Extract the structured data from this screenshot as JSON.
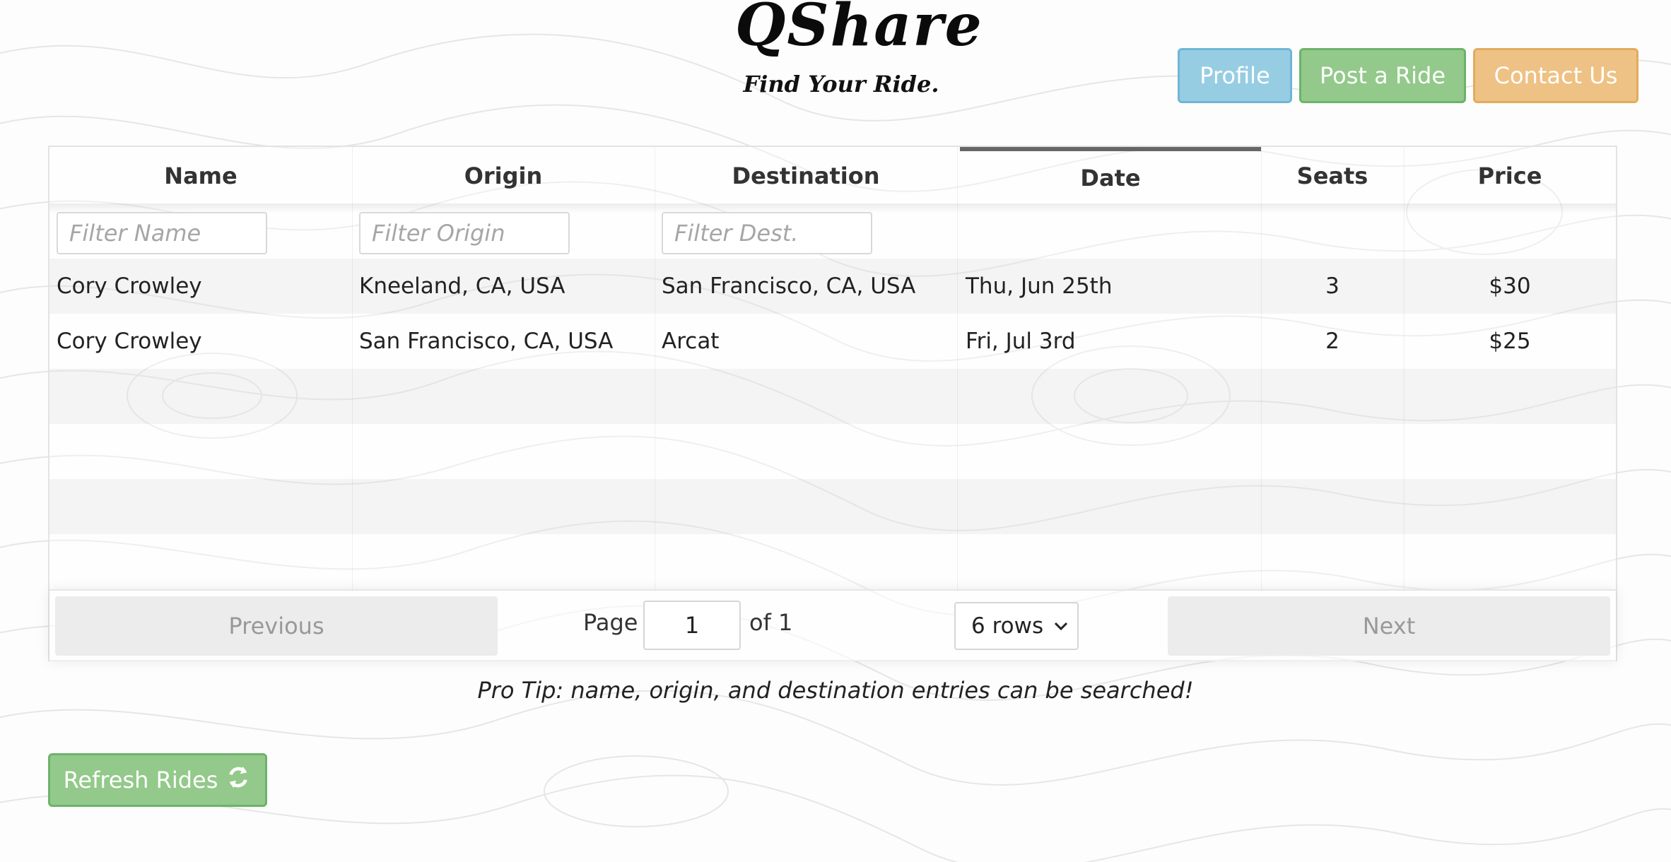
{
  "logo": {
    "title": "QShare",
    "tagline": "Find Your Ride."
  },
  "nav": {
    "profile_label": "Profile",
    "post_label": "Post a Ride",
    "contact_label": "Contact Us"
  },
  "table": {
    "headers": [
      "Name",
      "Origin",
      "Destination",
      "Date",
      "Seats",
      "Price"
    ],
    "filters": {
      "name_placeholder": "Filter Name",
      "origin_placeholder": "Filter Origin",
      "dest_placeholder": "Filter Dest."
    },
    "rows": [
      [
        "Cory Crowley",
        "Kneeland, CA, USA",
        "San Francisco, CA, USA",
        "Thu, Jun 25th",
        "3",
        "$30"
      ],
      [
        "Cory Crowley",
        "San Francisco, CA, USA",
        "Arcat",
        "Fri, Jul 3rd",
        "2",
        "$25"
      ]
    ]
  },
  "pagination": {
    "previous_label": "Previous",
    "next_label": "Next",
    "page_label": "Page",
    "page_value": "1",
    "of_label": "of 1",
    "rows_selected": "6 rows"
  },
  "protip": "Pro Tip: name, origin, and destination entries can be searched!",
  "refresh_label": "Refresh Rides",
  "colors": {
    "profile": "#97cde2",
    "post": "#93c98a",
    "contact": "#eec184",
    "refresh": "#93c98a"
  }
}
